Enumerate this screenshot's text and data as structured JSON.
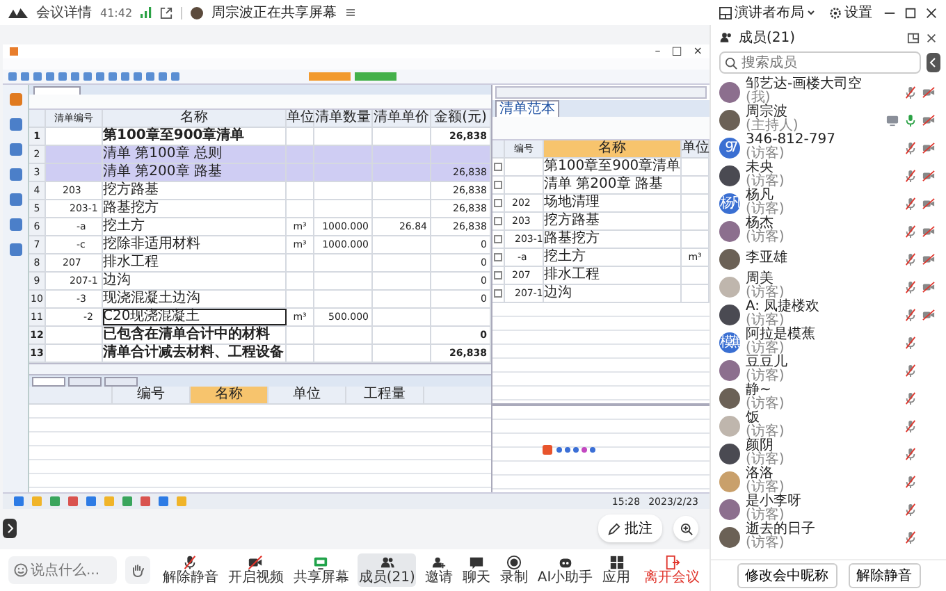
{
  "top_bar": {
    "app_label": "会议详情",
    "duration": "41:42",
    "sharing_notice": "周宗波正在共享屏幕",
    "layout_button": "演讲者布局",
    "settings_button": "设置"
  },
  "shared_screen": {
    "window_controls": [
      "–",
      "□",
      "×"
    ],
    "main_table": {
      "columns": [
        "清单编号",
        "名称",
        "单位",
        "清单数量",
        "清单单价",
        "金额(元)"
      ],
      "rows": [
        {
          "no": "1",
          "name": "第100章至900章清单",
          "amount": "26,838",
          "bold": true,
          "highlighted": false,
          "selected": false,
          "children": [
            {
              "no": "2",
              "name": "清单 第100章  总则",
              "bold": false,
              "highlighted": true,
              "selected": false
            },
            {
              "no": "3",
              "name": "清单 第200章  路基",
              "amount": "26,838",
              "bold": false,
              "highlighted": true,
              "selected": false,
              "children": [
                {
                  "no": "4",
                  "code": "203",
                  "name": "挖方路基",
                  "amount": "26,838",
                  "bold": false,
                  "highlighted": false,
                  "selected": false,
                  "children": [
                    {
                      "no": "5",
                      "code": "203-1",
                      "name": "路基挖方",
                      "amount": "26,838",
                      "bold": false,
                      "highlighted": false,
                      "selected": false,
                      "children": [
                        {
                          "no": "6",
                          "code": "-a",
                          "name": "挖土方",
                          "unit": "m³",
                          "qty": "1000.000",
                          "price": "26.84",
                          "amount": "26,838",
                          "bold": false,
                          "highlighted": false,
                          "selected": false
                        },
                        {
                          "no": "7",
                          "code": "-c",
                          "name": "挖除非适用材料",
                          "unit": "m³",
                          "qty": "1000.000",
                          "amount": "0",
                          "bold": false,
                          "highlighted": false,
                          "selected": false
                        }
                      ]
                    }
                  ]
                },
                {
                  "no": "8",
                  "code": "207",
                  "name": "排水工程",
                  "amount": "0",
                  "bold": false,
                  "highlighted": false,
                  "selected": false,
                  "children": [
                    {
                      "no": "9",
                      "code": "207-1",
                      "name": "边沟",
                      "amount": "0",
                      "bold": false,
                      "highlighted": false,
                      "selected": false,
                      "children": [
                        {
                          "no": "10",
                          "code": "-3",
                          "name": "现浇混凝土边沟",
                          "amount": "0",
                          "bold": false,
                          "highlighted": false,
                          "selected": false,
                          "children": [
                            {
                              "no": "11",
                              "code": "-2",
                              "name": "C20现浇混凝土",
                              "unit": "m³",
                              "qty": "500.000",
                              "bold": false,
                              "highlighted": false,
                              "selected": true
                            }
                          ]
                        }
                      ]
                    }
                  ]
                }
              ]
            }
          ]
        },
        {
          "no": "12",
          "name": "已包含在清单合计中的材料",
          "amount": "0",
          "bold": true,
          "highlighted": false,
          "selected": false
        },
        {
          "no": "13",
          "name": "清单合计减去材料、工程设备",
          "amount": "26,838",
          "bold": true,
          "highlighted": false,
          "selected": false
        }
      ]
    },
    "panel_tabs": [
      {
        "selected": true
      },
      {
        "selected": false
      },
      {
        "selected": false
      }
    ],
    "lower_table": {
      "columns": [
        "编号",
        "名称",
        "单位",
        "工程量"
      ]
    },
    "library_tab": "清单范本",
    "library_table": {
      "columns": [
        "编号",
        "名称",
        "单位"
      ],
      "rows": [
        {
          "name": "第100章至900章清单",
          "checked": false,
          "children": [
            {
              "name": "清单 第200章  路基",
              "checked": false,
              "children": [
                {
                  "code": "202",
                  "name": "场地清理",
                  "checked": false
                },
                {
                  "code": "203",
                  "name": "挖方路基",
                  "checked": false,
                  "children": [
                    {
                      "code": "203-1",
                      "name": "路基挖方",
                      "checked": false,
                      "children": [
                        {
                          "code": "-a",
                          "name": "挖土方",
                          "unit": "m³",
                          "checked": false
                        }
                      ]
                    }
                  ]
                },
                {
                  "code": "207",
                  "name": "排水工程",
                  "checked": false,
                  "children": [
                    {
                      "code": "207-1",
                      "name": "边沟",
                      "checked": false
                    }
                  ]
                }
              ]
            }
          ]
        }
      ]
    },
    "taskbar": {
      "time": "15:28",
      "date": "2023/2/23"
    }
  },
  "annotate_button": "批注",
  "members_panel": {
    "title": "成员(21)",
    "search_placeholder": "搜索成员",
    "members": [
      {
        "name": "邹艺达-画楼大司空",
        "role": "(我)",
        "muted": true,
        "camera_off": true,
        "sharing": false
      },
      {
        "name": "周宗波",
        "role": "(主持人)",
        "muted": false,
        "camera_off": true,
        "sharing": true
      },
      {
        "name": "346-812-797",
        "role": "(访客)",
        "avatar_text": "97",
        "muted": true,
        "camera_off": true,
        "sharing": false
      },
      {
        "name": "未央",
        "role": "(访客)",
        "muted": true,
        "camera_off": true,
        "sharing": false
      },
      {
        "name": "杨凡",
        "role": "(访客)",
        "avatar_text": "杨凡",
        "muted": true,
        "camera_off": true,
        "sharing": false
      },
      {
        "name": "杨杰",
        "role": "(访客)",
        "muted": true,
        "camera_off": true,
        "sharing": false
      },
      {
        "name": "李亚雄",
        "muted": true,
        "camera_off": true,
        "sharing": false
      },
      {
        "name": "周美",
        "role": "(访客)",
        "muted": true,
        "camera_off": true,
        "sharing": false
      },
      {
        "name": "A: 凤捷楼欢",
        "role": "(访客)",
        "muted": true,
        "camera_off": true,
        "sharing": false
      },
      {
        "name": "阿拉是模蕉",
        "role": "(访客)",
        "avatar_text": "模蕉",
        "muted": true,
        "camera_off": false,
        "sharing": false
      },
      {
        "name": "豆豆儿",
        "role": "(访客)",
        "muted": true,
        "camera_off": false,
        "sharing": false
      },
      {
        "name": "静~",
        "role": "(访客)",
        "muted": true,
        "camera_off": false,
        "sharing": false
      },
      {
        "name": "饭",
        "role": "(访客)",
        "muted": true,
        "camera_off": false,
        "sharing": false
      },
      {
        "name": "颜阴",
        "role": "(访客)",
        "muted": true,
        "camera_off": false,
        "sharing": false
      },
      {
        "name": "洛洛",
        "role": "(访客)",
        "muted": true,
        "camera_off": false,
        "sharing": false
      },
      {
        "name": "是小李呀",
        "role": "(访客)",
        "muted": true,
        "camera_off": false,
        "sharing": false
      },
      {
        "name": "逝去的日子",
        "role": "(访客)",
        "muted": true,
        "camera_off": false,
        "sharing": false
      }
    ],
    "buttons": [
      "修改会中昵称",
      "解除静音"
    ]
  },
  "toolbar": {
    "chat_placeholder": "说点什么...",
    "items": [
      {
        "kind": "mic",
        "label": "解除静音",
        "selected": false
      },
      {
        "kind": "video",
        "label": "开启视频",
        "selected": false
      },
      {
        "kind": "share",
        "label": "共享屏幕",
        "selected": false
      },
      {
        "kind": "members",
        "label": "成员(21)",
        "selected": true
      },
      {
        "kind": "invite",
        "label": "邀请",
        "selected": false
      },
      {
        "kind": "chat",
        "label": "聊天",
        "selected": false
      },
      {
        "kind": "record",
        "label": "录制",
        "selected": false
      },
      {
        "kind": "ai",
        "label": "AI小助手",
        "selected": false
      },
      {
        "kind": "apps",
        "label": "应用",
        "selected": false
      }
    ],
    "leave_button": "离开会议"
  }
}
